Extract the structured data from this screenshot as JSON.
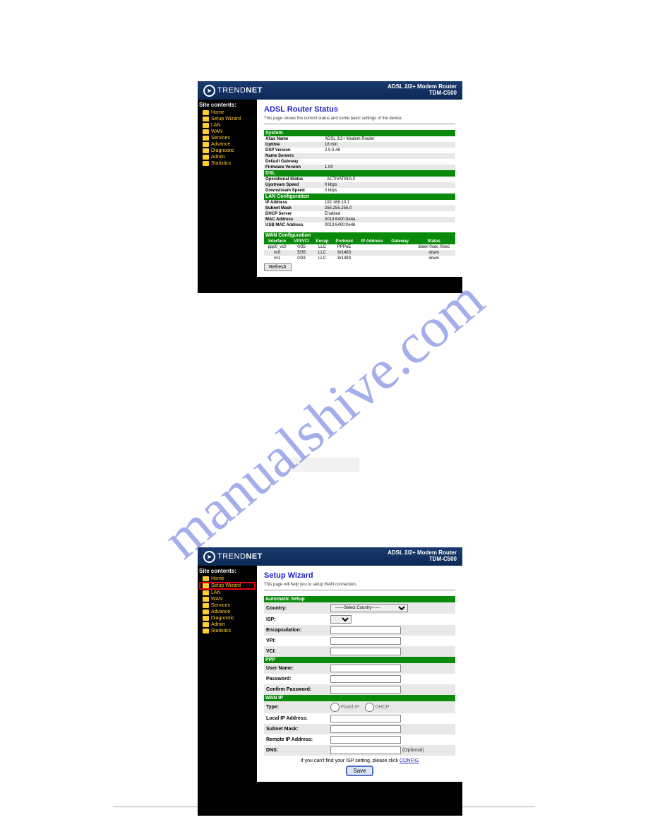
{
  "watermark": "manualshive.com",
  "header": {
    "brand": "TRENDNET",
    "brand_prefix": "TREND",
    "brand_suffix": "NET",
    "product": "ADSL 2/2+ Modem Router",
    "model": "TDM-C500"
  },
  "sidebar": {
    "title": "Site contents:",
    "items": [
      {
        "label": "Home"
      },
      {
        "label": "Setup Wizard"
      },
      {
        "label": "LAN"
      },
      {
        "label": "WAN"
      },
      {
        "label": "Services"
      },
      {
        "label": "Advance"
      },
      {
        "label": "Diagnostic"
      },
      {
        "label": "Admin"
      },
      {
        "label": "Statistics"
      }
    ]
  },
  "status_page": {
    "title": "ADSL Router Status",
    "subtitle": "This page shows the current status and some basic settings of the device.",
    "sections": {
      "system": {
        "label": "System",
        "rows": [
          {
            "k": "Alias Name",
            "v": "ADSL 2/2+ Modem Router"
          },
          {
            "k": "Uptime",
            "v": "18 min"
          },
          {
            "k": "DSP Version",
            "v": "2.9.0.48"
          },
          {
            "k": "Name Servers",
            "v": ""
          },
          {
            "k": "Default Gateway",
            "v": ""
          },
          {
            "k": "Firmware Version",
            "v": "1.00"
          }
        ]
      },
      "dsl": {
        "label": "DSL",
        "rows": [
          {
            "k": "Operational Status",
            "v": ", ACTIVATING,0"
          },
          {
            "k": "Upstream Speed",
            "v": "0 kbps"
          },
          {
            "k": "Downstream Speed",
            "v": "0 kbps"
          }
        ]
      },
      "lan": {
        "label": "LAN Configuration",
        "rows": [
          {
            "k": "IP Address",
            "v": "192.168.10.1"
          },
          {
            "k": "Subnet Mask",
            "v": "255.255.255.0"
          },
          {
            "k": "DHCP Server",
            "v": "Enabled"
          },
          {
            "k": "MAC Address",
            "v": "0013:6400:0e4a"
          },
          {
            "k": "USB MAC Address",
            "v": "0013:6400:0e4b"
          }
        ]
      },
      "wan": {
        "label": "WAN Configuration",
        "headers": [
          "Interface",
          "VPI/VCI",
          "Encap",
          "Protocol",
          "IP Address",
          "Gateway",
          "Status"
        ],
        "rows": [
          {
            "c": [
              "ppp0_vc0",
              "0/35",
              "LLC",
              "PPPoE",
              "",
              "",
              "down 0sec /0sec"
            ]
          },
          {
            "c": [
              "vc0",
              "5/35",
              "LLC",
              "br1483",
              "",
              "",
              "down"
            ]
          },
          {
            "c": [
              "vc1",
              "0/33",
              "LLC",
              "br1483",
              "",
              "",
              "down"
            ]
          }
        ]
      }
    },
    "refresh_label": "Refresh"
  },
  "wizard_page": {
    "title": "Setup Wizard",
    "subtitle": "This page will help you to setup WAN connection.",
    "sections": {
      "auto": {
        "label": "Automatic Setup",
        "country_label": "Country:",
        "country_placeholder": "------Select Country------",
        "isp_label": "ISP:",
        "encap_label": "Encapsulation:",
        "vpi_label": "VPI:",
        "vci_label": "VCI:"
      },
      "ppp": {
        "label": "PPP",
        "user_label": "User Name:",
        "pass_label": "Password:",
        "confirm_label": "Confirm Password:"
      },
      "wanip": {
        "label": "WAN IP",
        "type_label": "Type:",
        "type_fixed": "Fixed IP",
        "type_dhcp": "DHCP",
        "local_label": "Local IP Address:",
        "subnet_label": "Subnet Mask:",
        "remote_label": "Remote IP Address:",
        "dns_label": "DNS:",
        "dns_optional": "(Optional)"
      }
    },
    "config_note_pre": "If you can't find your ISP setting, please click ",
    "config_link": "CONFIG",
    "save_label": "Save"
  }
}
